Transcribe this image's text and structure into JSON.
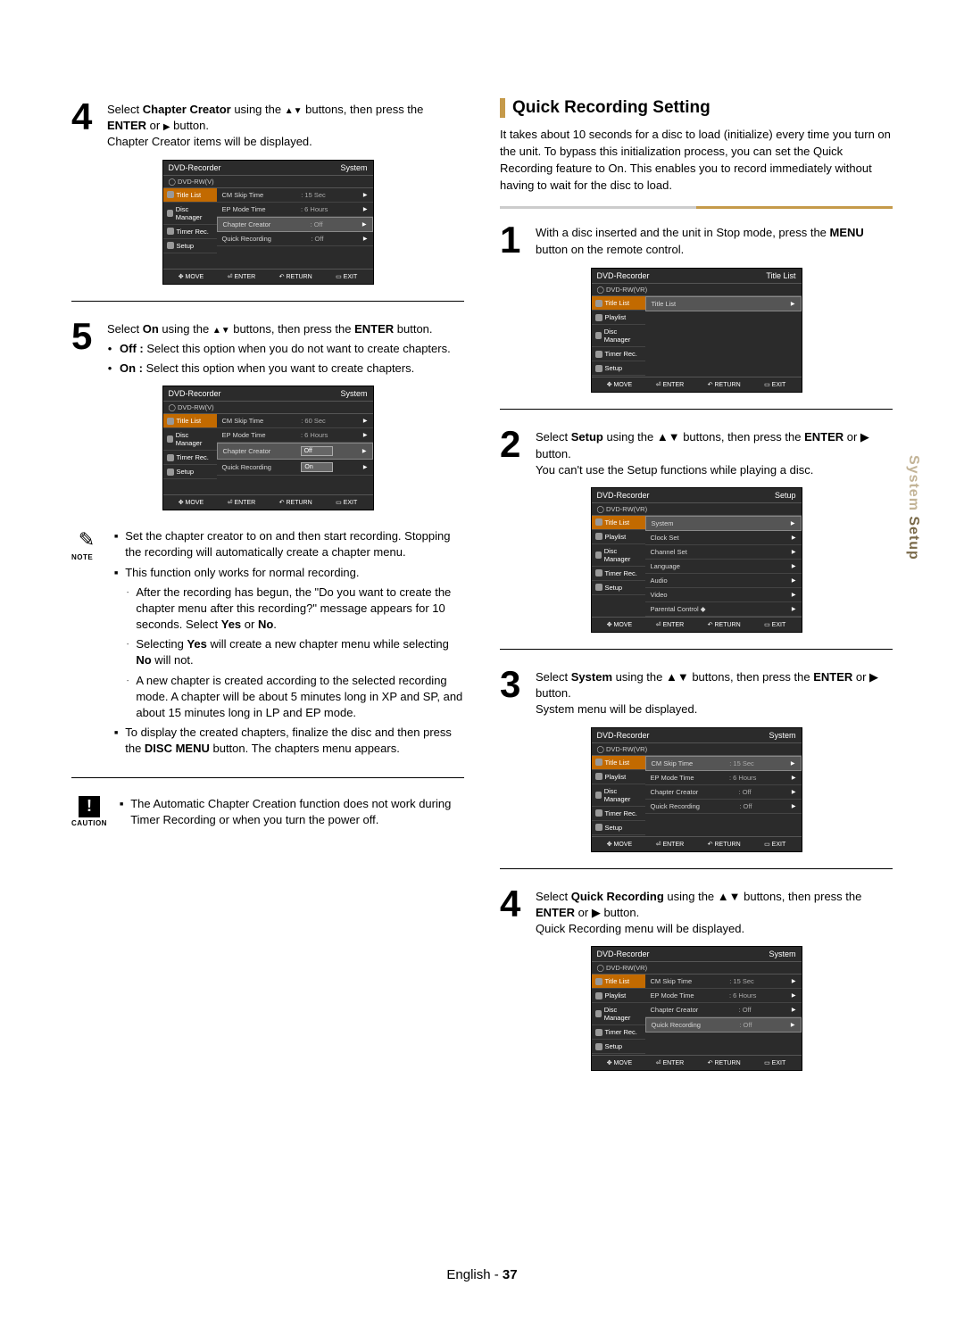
{
  "left": {
    "step4": {
      "num": "4",
      "text_pre": "Select ",
      "text_b1": "Chapter Creator",
      "text_mid": " using the ",
      "text_arrows": "▲▼",
      "text_post": " buttons, then press the ",
      "text_b2": "ENTER",
      "text_or": " or ",
      "text_play": "▶",
      "text_end": " button.",
      "line2": "Chapter Creator items will be displayed."
    },
    "osd1": {
      "title_l": "DVD-Recorder",
      "title_r": "System",
      "sub": "DVD-RW(V)",
      "side": [
        "Title List",
        "Disc Manager",
        "Timer Rec.",
        "Setup"
      ],
      "rows": [
        {
          "k": "CM Skip Time",
          "v": ": 15 Sec",
          "hl": false
        },
        {
          "k": "EP Mode Time",
          "v": ": 6 Hours",
          "hl": false
        },
        {
          "k": "Chapter Creator",
          "v": ": Off",
          "hl": true
        },
        {
          "k": "Quick Recording",
          "v": ": Off",
          "hl": false
        }
      ],
      "footer": [
        "✥ MOVE",
        "⏎ ENTER",
        "↶ RETURN",
        "▭ EXIT"
      ]
    },
    "step5": {
      "num": "5",
      "text_pre": "Select ",
      "text_b1": "On",
      "text_mid": " using the ",
      "text_arrows": "▲▼",
      "text_post": " buttons, then press the ",
      "text_b2": "ENTER",
      "text_end": " button.",
      "b_off": "Off :",
      "off_text": " Select this option when you do not want to create chapters.",
      "b_on": "On :",
      "on_text": " Select this option when you want to create chapters."
    },
    "osd2": {
      "title_l": "DVD-Recorder",
      "title_r": "System",
      "sub": "DVD-RW(V)",
      "side": [
        "Title List",
        "Disc Manager",
        "Timer Rec.",
        "Setup"
      ],
      "rows": [
        {
          "k": "CM Skip Time",
          "v": ": 60 Sec",
          "hl": false
        },
        {
          "k": "EP Mode Time",
          "v": ": 6 Hours",
          "hl": false
        },
        {
          "k": "Chapter Creator",
          "v": "",
          "opt": "Off",
          "hl": true
        },
        {
          "k": "Quick Recording",
          "v": "",
          "opt": "On",
          "hl": false
        }
      ],
      "footer": [
        "✥ MOVE",
        "⏎ ENTER",
        "↶ RETURN",
        "▭ EXIT"
      ]
    },
    "note_label": "NOTE",
    "note_items": [
      "Set the chapter creator to on and then start recording. Stopping the recording will automatically create a chapter menu.",
      "This function only works for normal recording."
    ],
    "note_sub": [
      "After the recording has begun, the \"Do you want to create the chapter menu after this recording?\" message appears for 10 seconds. Select <b>Yes</b> or <b>No</b>.",
      "Selecting <b>Yes</b> will create a new chapter menu while selecting <b>No</b> will not.",
      "A new chapter is created according to the selected recording mode. A chapter will be about 5 minutes long in XP and SP, and about 15 minutes long in LP and EP mode."
    ],
    "note_last": "To display the created chapters, finalize the disc and then press the <b>DISC MENU</b> button. The chapters menu appears.",
    "caution_label": "CAUTION",
    "caution_text": "The Automatic Chapter Creation function does not work during Timer Recording or when you turn the power off."
  },
  "right": {
    "heading": "Quick Recording Setting",
    "intro": "It takes about 10 seconds for a disc to load (initialize) every time you turn on the unit. To bypass this initialization process, you can set the Quick Recording feature to On. This enables you to record immediately without having to wait for the disc to load.",
    "step1": {
      "num": "1",
      "text": "With a disc inserted and the unit in Stop mode, press the <b>MENU</b> button on the remote control."
    },
    "osd1": {
      "title_l": "DVD-Recorder",
      "title_r": "Title List",
      "sub": "DVD-RW(VR)",
      "side": [
        "Title List",
        "Playlist",
        "Disc Manager",
        "Timer Rec.",
        "Setup"
      ],
      "rows": [
        {
          "k": "Title List",
          "v": "",
          "hl": true
        }
      ],
      "footer": [
        "✥ MOVE",
        "⏎ ENTER",
        "↶ RETURN",
        "▭ EXIT"
      ]
    },
    "step2": {
      "num": "2",
      "text": "Select <b>Setup</b> using the ▲▼ buttons, then press the <b>ENTER</b> or ▶ button.",
      "line2": "You can't use the Setup functions while playing a disc."
    },
    "osd2": {
      "title_l": "DVD-Recorder",
      "title_r": "Setup",
      "sub": "DVD-RW(VR)",
      "side": [
        "Title List",
        "Playlist",
        "Disc Manager",
        "Timer Rec.",
        "Setup"
      ],
      "rows": [
        {
          "k": "System",
          "v": "",
          "hl": true
        },
        {
          "k": "Clock Set",
          "v": "",
          "hl": false
        },
        {
          "k": "Channel Set",
          "v": "",
          "hl": false
        },
        {
          "k": "Language",
          "v": "",
          "hl": false
        },
        {
          "k": "Audio",
          "v": "",
          "hl": false
        },
        {
          "k": "Video",
          "v": "",
          "hl": false
        },
        {
          "k": "Parental Control ◆",
          "v": "",
          "hl": false
        }
      ],
      "footer": [
        "✥ MOVE",
        "⏎ ENTER",
        "↶ RETURN",
        "▭ EXIT"
      ]
    },
    "step3": {
      "num": "3",
      "text": "Select <b>System</b> using the ▲▼ buttons, then press the <b>ENTER</b> or ▶ button.",
      "line2": "System menu will be displayed."
    },
    "osd3": {
      "title_l": "DVD-Recorder",
      "title_r": "System",
      "sub": "DVD-RW(VR)",
      "side": [
        "Title List",
        "Playlist",
        "Disc Manager",
        "Timer Rec.",
        "Setup"
      ],
      "rows": [
        {
          "k": "CM Skip Time",
          "v": ": 15 Sec",
          "hl": true
        },
        {
          "k": "EP Mode Time",
          "v": ": 6 Hours",
          "hl": false
        },
        {
          "k": "Chapter Creator",
          "v": ": Off",
          "hl": false
        },
        {
          "k": "Quick Recording",
          "v": ": Off",
          "hl": false
        }
      ],
      "footer": [
        "✥ MOVE",
        "⏎ ENTER",
        "↶ RETURN",
        "▭ EXIT"
      ]
    },
    "step4": {
      "num": "4",
      "text": "Select <b>Quick Recording</b> using the ▲▼ buttons, then press the <b>ENTER</b> or ▶ button.",
      "line2": "Quick Recording menu will be displayed."
    },
    "osd4": {
      "title_l": "DVD-Recorder",
      "title_r": "System",
      "sub": "DVD-RW(VR)",
      "side": [
        "Title List",
        "Playlist",
        "Disc Manager",
        "Timer Rec.",
        "Setup"
      ],
      "rows": [
        {
          "k": "CM Skip Time",
          "v": ": 15 Sec",
          "hl": false
        },
        {
          "k": "EP Mode Time",
          "v": ": 6 Hours",
          "hl": false
        },
        {
          "k": "Chapter Creator",
          "v": ": Off",
          "hl": false
        },
        {
          "k": "Quick Recording",
          "v": ": Off",
          "hl": true
        }
      ],
      "footer": [
        "✥ MOVE",
        "⏎ ENTER",
        "↶ RETURN",
        "▭ EXIT"
      ]
    }
  },
  "side_tab_a": "System",
  "side_tab_b": " Setup",
  "footer_lang": "English - ",
  "footer_page": "37"
}
